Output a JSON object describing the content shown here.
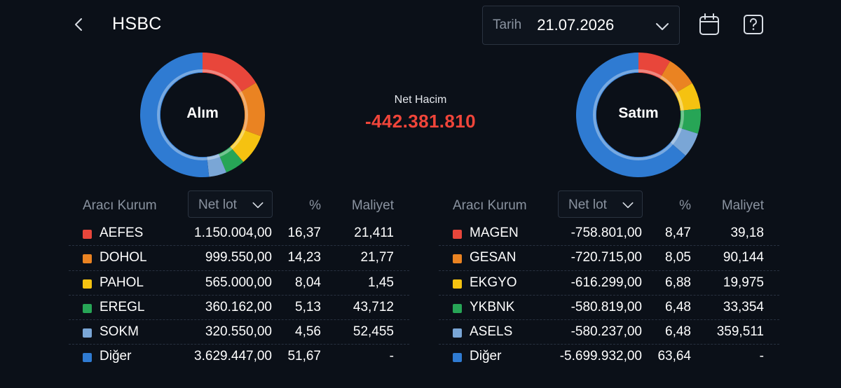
{
  "header": {
    "title": "HSBC",
    "date_label": "Tarih",
    "date_value": "21.07.2026"
  },
  "center": {
    "net_label": "Net Hacim",
    "net_value": "-442.381.810"
  },
  "colors": {
    "red": "#e8463b",
    "orange": "#ea8322",
    "yellow": "#f5c211",
    "green": "#27a556",
    "lightblue": "#7aa6d6",
    "blue": "#2f7bd2",
    "negative": "#f0453a"
  },
  "buy": {
    "donut_label": "Alım",
    "headers": {
      "broker": "Aracı Kurum",
      "sort": "Net lot",
      "pct": "%",
      "cost": "Maliyet"
    },
    "rows": [
      {
        "name": "AEFES",
        "lot": "1.150.004,00",
        "pct": "16,37",
        "cost": "21,411",
        "share": 16.37,
        "color": "#e8463b"
      },
      {
        "name": "DOHOL",
        "lot": "999.550,00",
        "pct": "14,23",
        "cost": "21,77",
        "share": 14.23,
        "color": "#ea8322"
      },
      {
        "name": "PAHOL",
        "lot": "565.000,00",
        "pct": "8,04",
        "cost": "1,45",
        "share": 8.04,
        "color": "#f5c211"
      },
      {
        "name": "EREGL",
        "lot": "360.162,00",
        "pct": "5,13",
        "cost": "43,712",
        "share": 5.13,
        "color": "#27a556"
      },
      {
        "name": "SOKM",
        "lot": "320.550,00",
        "pct": "4,56",
        "cost": "52,455",
        "share": 4.56,
        "color": "#7aa6d6"
      },
      {
        "name": "Diğer",
        "lot": "3.629.447,00",
        "pct": "51,67",
        "cost": "-",
        "share": 51.67,
        "color": "#2f7bd2"
      }
    ]
  },
  "sell": {
    "donut_label": "Satım",
    "headers": {
      "broker": "Aracı Kurum",
      "sort": "Net lot",
      "pct": "%",
      "cost": "Maliyet"
    },
    "rows": [
      {
        "name": "MAGEN",
        "lot": "-758.801,00",
        "pct": "8,47",
        "cost": "39,18",
        "share": 8.47,
        "color": "#e8463b"
      },
      {
        "name": "GESAN",
        "lot": "-720.715,00",
        "pct": "8,05",
        "cost": "90,144",
        "share": 8.05,
        "color": "#ea8322"
      },
      {
        "name": "EKGYO",
        "lot": "-616.299,00",
        "pct": "6,88",
        "cost": "19,975",
        "share": 6.88,
        "color": "#f5c211"
      },
      {
        "name": "YKBNK",
        "lot": "-580.819,00",
        "pct": "6,48",
        "cost": "33,354",
        "share": 6.48,
        "color": "#27a556"
      },
      {
        "name": "ASELS",
        "lot": "-580.237,00",
        "pct": "6,48",
        "cost": "359,511",
        "share": 6.48,
        "color": "#7aa6d6"
      },
      {
        "name": "Diğer",
        "lot": "-5.699.932,00",
        "pct": "63,64",
        "cost": "-",
        "share": 63.64,
        "color": "#2f7bd2"
      }
    ]
  }
}
